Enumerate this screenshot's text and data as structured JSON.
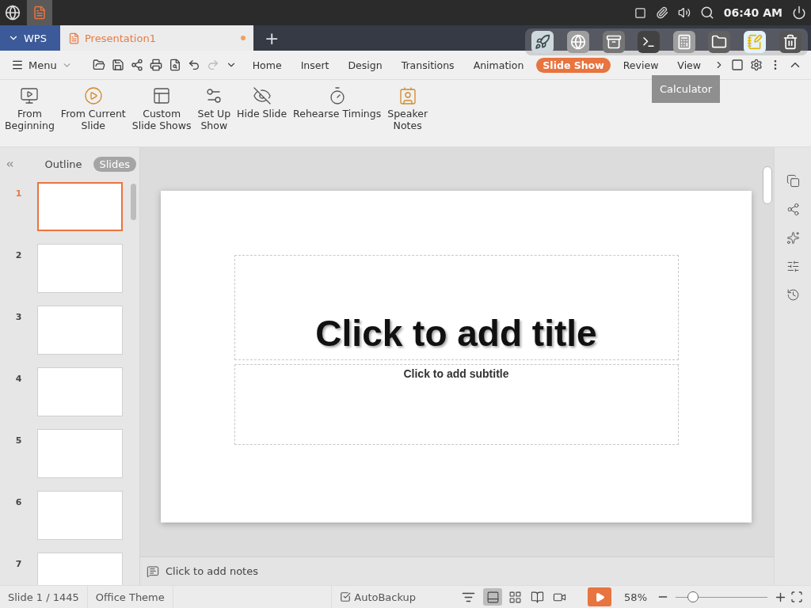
{
  "system_bar": {
    "clock": "06:40 AM"
  },
  "tabs": [
    {
      "label": "WPS",
      "kind": "home",
      "selected": false,
      "unsaved": false
    },
    {
      "label": "Presentation1",
      "kind": "document",
      "selected": true,
      "unsaved": true
    }
  ],
  "new_tab": "+",
  "menu": {
    "label": "Menu"
  },
  "ribbon_tabs": [
    {
      "label": "Home",
      "selected": false
    },
    {
      "label": "Insert",
      "selected": false
    },
    {
      "label": "Design",
      "selected": false
    },
    {
      "label": "Transitions",
      "selected": false
    },
    {
      "label": "Animation",
      "selected": false
    },
    {
      "label": "Slide Show",
      "selected": true
    },
    {
      "label": "Review",
      "selected": false
    },
    {
      "label": "View",
      "selected": false
    }
  ],
  "ribbon_buttons": [
    {
      "label": "From\nBeginning",
      "kind": "beginning"
    },
    {
      "label": "From Current\nSlide",
      "kind": "current"
    },
    {
      "label": "Custom\nSlide Shows",
      "kind": "custom"
    },
    {
      "label": "Set Up\nShow",
      "kind": "setup"
    },
    {
      "label": "Hide Slide",
      "kind": "hide"
    },
    {
      "label": "Rehearse Timings",
      "kind": "timings"
    },
    {
      "label": "Speaker\nNotes",
      "kind": "notes"
    }
  ],
  "panel_tabs": [
    {
      "label": "Outline",
      "selected": false
    },
    {
      "label": "Slides",
      "selected": true
    }
  ],
  "slides": [
    {
      "number": "1",
      "selected": true
    },
    {
      "number": "2",
      "selected": false
    },
    {
      "number": "3",
      "selected": false
    },
    {
      "number": "4",
      "selected": false
    },
    {
      "number": "5",
      "selected": false
    },
    {
      "number": "6",
      "selected": false
    },
    {
      "number": "7",
      "selected": false
    }
  ],
  "slide": {
    "title": "Click to add title",
    "subtitle": "Click to add subtitle"
  },
  "notes": {
    "placeholder": "Click to add notes"
  },
  "status_bar": {
    "slide": "Slide 1 / 1445",
    "theme": "Office Theme",
    "autobackup": "AutoBackup",
    "zoom": "58%",
    "zoom_slider": {
      "level": 0.19
    }
  },
  "views": [
    {
      "kind": "normal",
      "selected": true
    },
    {
      "kind": "sorter",
      "selected": false
    },
    {
      "kind": "reading",
      "selected": false
    },
    {
      "kind": "record",
      "selected": false
    }
  ],
  "dock": {
    "tooltip": "Calculator"
  }
}
